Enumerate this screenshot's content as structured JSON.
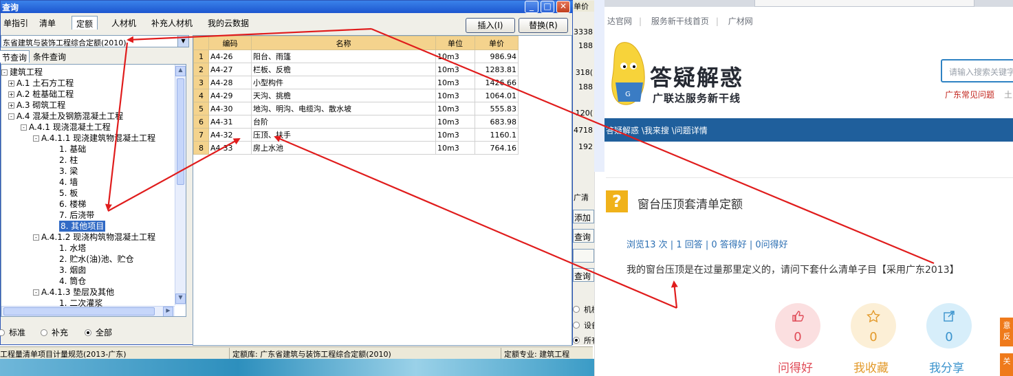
{
  "dialog": {
    "title": "查询",
    "top_tabs": [
      "单指引",
      "清单",
      "定额",
      "人材机",
      "补充人材机",
      "我的云数据"
    ],
    "active_tab": "定额",
    "insert_button": "插入(I)",
    "replace_button": "替换(R)",
    "quota_library": "东省建筑与装饰工程综合定额(2010)",
    "sub_tabs": [
      "节查询",
      "条件查询"
    ],
    "tree": [
      {
        "text": "建筑工程",
        "level": 0,
        "box": "⊝"
      },
      {
        "text": "A.1 土石方工程",
        "level": 1,
        "box": "+"
      },
      {
        "text": "A.2 桩基础工程",
        "level": 1,
        "box": "+"
      },
      {
        "text": "A.3 砌筑工程",
        "level": 1,
        "box": "+"
      },
      {
        "text": "A.4 混凝土及钢筋混凝土工程",
        "level": 1,
        "box": "-"
      },
      {
        "text": "A.4.1 现浇混凝土工程",
        "level": 2,
        "box": "-"
      },
      {
        "text": "A.4.1.1 现浇建筑物混凝土工程",
        "level": 3,
        "box": "-"
      },
      {
        "text": "1. 基础",
        "level": 4
      },
      {
        "text": "2. 柱",
        "level": 4
      },
      {
        "text": "3. 梁",
        "level": 4
      },
      {
        "text": "4. 墙",
        "level": 4
      },
      {
        "text": "5. 板",
        "level": 4
      },
      {
        "text": "6. 楼梯",
        "level": 4
      },
      {
        "text": "7. 后浇带",
        "level": 4
      },
      {
        "text": "8. 其他项目",
        "level": 4,
        "selected": true
      },
      {
        "text": "A.4.1.2 现浇构筑物混凝土工程",
        "level": 3,
        "box": "-"
      },
      {
        "text": "1. 水塔",
        "level": 4
      },
      {
        "text": "2. 贮水(油)池、贮仓",
        "level": 4
      },
      {
        "text": "3. 烟囱",
        "level": 4
      },
      {
        "text": "4. 筒仓",
        "level": 4
      },
      {
        "text": "A.4.1.3 垫层及其他",
        "level": 3,
        "box": "-"
      },
      {
        "text": "1. 二次灌浆",
        "level": 4
      }
    ],
    "radios": [
      {
        "label": "标准",
        "checked": false
      },
      {
        "label": "补充",
        "checked": false
      },
      {
        "label": "全部",
        "checked": true
      }
    ],
    "table_headers": [
      "编码",
      "名称",
      "单位",
      "单价"
    ],
    "rows": [
      {
        "n": "1",
        "code": "A4-26",
        "name": "阳台、雨篷",
        "unit": "10m3",
        "price": "986.94"
      },
      {
        "n": "2",
        "code": "A4-27",
        "name": "栏板、反檐",
        "unit": "10m3",
        "price": "1283.81"
      },
      {
        "n": "3",
        "code": "A4-28",
        "name": "小型构件",
        "unit": "10m3",
        "price": "1426.66"
      },
      {
        "n": "4",
        "code": "A4-29",
        "name": "天沟、挑檐",
        "unit": "10m3",
        "price": "1064.01"
      },
      {
        "n": "5",
        "code": "A4-30",
        "name": "地沟、明沟、电缆沟、散水坡",
        "unit": "10m3",
        "price": "555.83"
      },
      {
        "n": "6",
        "code": "A4-31",
        "name": "台阶",
        "unit": "10m3",
        "price": "683.98"
      },
      {
        "n": "7",
        "code": "A4-32",
        "name": "压顶、扶手",
        "unit": "10m3",
        "price": "1160.1"
      },
      {
        "n": "8",
        "code": "A4-33",
        "name": "房上水池",
        "unit": "10m3",
        "price": "764.16"
      }
    ]
  },
  "status_bar": {
    "left": "工程量清单项目计量规范(2013-广东)",
    "middle": "定额库: 广东省建筑与装饰工程综合定额(2010)",
    "right": "定额专业: 建筑工程"
  },
  "bg_app": {
    "header": "单价",
    "cells": [
      "3338",
      "188",
      "318(",
      "188",
      "120(",
      "4718",
      "192"
    ],
    "buttons": [
      "添加",
      "查询",
      "",
      "查询"
    ],
    "label": "广清",
    "radios": [
      "机械",
      "设备",
      "所有"
    ]
  },
  "web": {
    "links": [
      "达官网",
      "服务新干线首页",
      "广材网"
    ],
    "brand": "答疑解惑",
    "brand_sub": "广联达服务新干线",
    "search_placeholder": "请输入搜索关键字",
    "hot_link": "广东常见问题",
    "hot_more": "土",
    "breadcrumb": "答疑解惑 \\我来搜 \\问题详情",
    "question_title": "窗台压顶套清单定额",
    "stats": "浏览13 次 | 1 回答 | 0 答得好 | 0问得好",
    "question_body": "我的窗台压顶是在过量那里定义的，请问下套什么清单子目【采用广东2013】",
    "actions": [
      {
        "label": "问得好",
        "count": "0",
        "icon": "thumb-up-icon",
        "bg": "#fbdfe0",
        "color": "#e04b57"
      },
      {
        "label": "我收藏",
        "count": "0",
        "icon": "star-icon",
        "bg": "#fcefd6",
        "color": "#e39a2b"
      },
      {
        "label": "我分享",
        "count": "0",
        "icon": "share-icon",
        "bg": "#d7eefa",
        "color": "#3a93cd"
      }
    ],
    "side_buttons": [
      "意反",
      "关"
    ]
  },
  "colors": {
    "annotation_arrow": "#e01c1c",
    "accent": "#316ac5",
    "nav": "#1f5f9c"
  }
}
